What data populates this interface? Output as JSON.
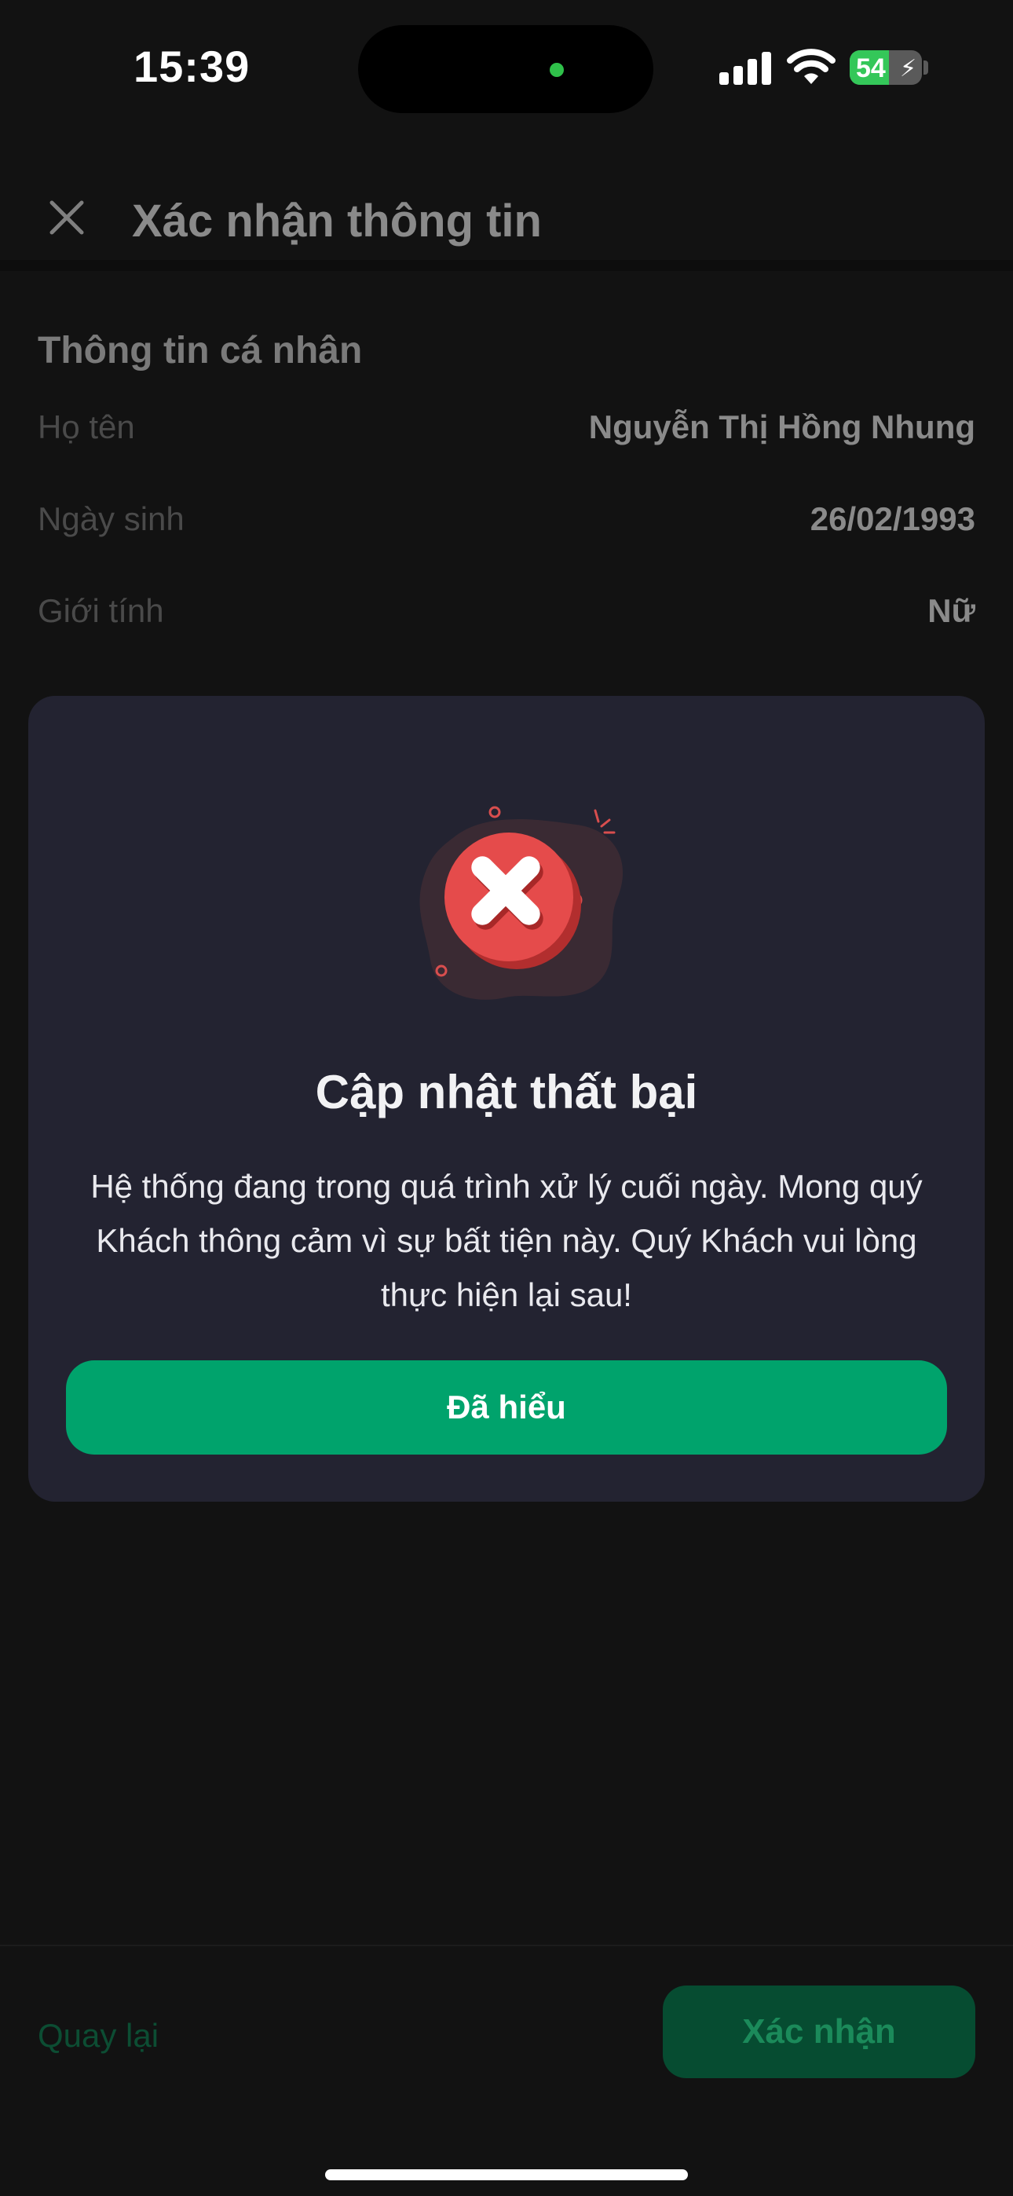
{
  "status_bar": {
    "time": "15:39",
    "battery_level": "54",
    "battery_percent": 54,
    "battery_color": "#34c759"
  },
  "header": {
    "close_icon": "close-icon",
    "title": "Xác nhận thông tin"
  },
  "personal_info": {
    "section_title": "Thông tin cá nhân",
    "rows": [
      {
        "label": "Họ tên",
        "value": "Nguyễn Thị Hồng Nhung"
      },
      {
        "label": "Ngày sinh",
        "value": "26/02/1993"
      },
      {
        "label": "Giới tính",
        "value": "Nữ"
      }
    ]
  },
  "modal": {
    "icon": "error-icon",
    "title": "Cập nhật thất bại",
    "message": "Hệ thống đang trong quá trình xử lý cuối ngày. Mong quý Khách thông cảm vì sự bất tiện này. Quý Khách vui lòng thực hiện lại sau!",
    "button_label": "Đã hiểu",
    "accent_color": "#00a36c",
    "error_color": "#e5484d"
  },
  "bottom_bar": {
    "back_label": "Quay lại",
    "confirm_label": "Xác nhận"
  }
}
